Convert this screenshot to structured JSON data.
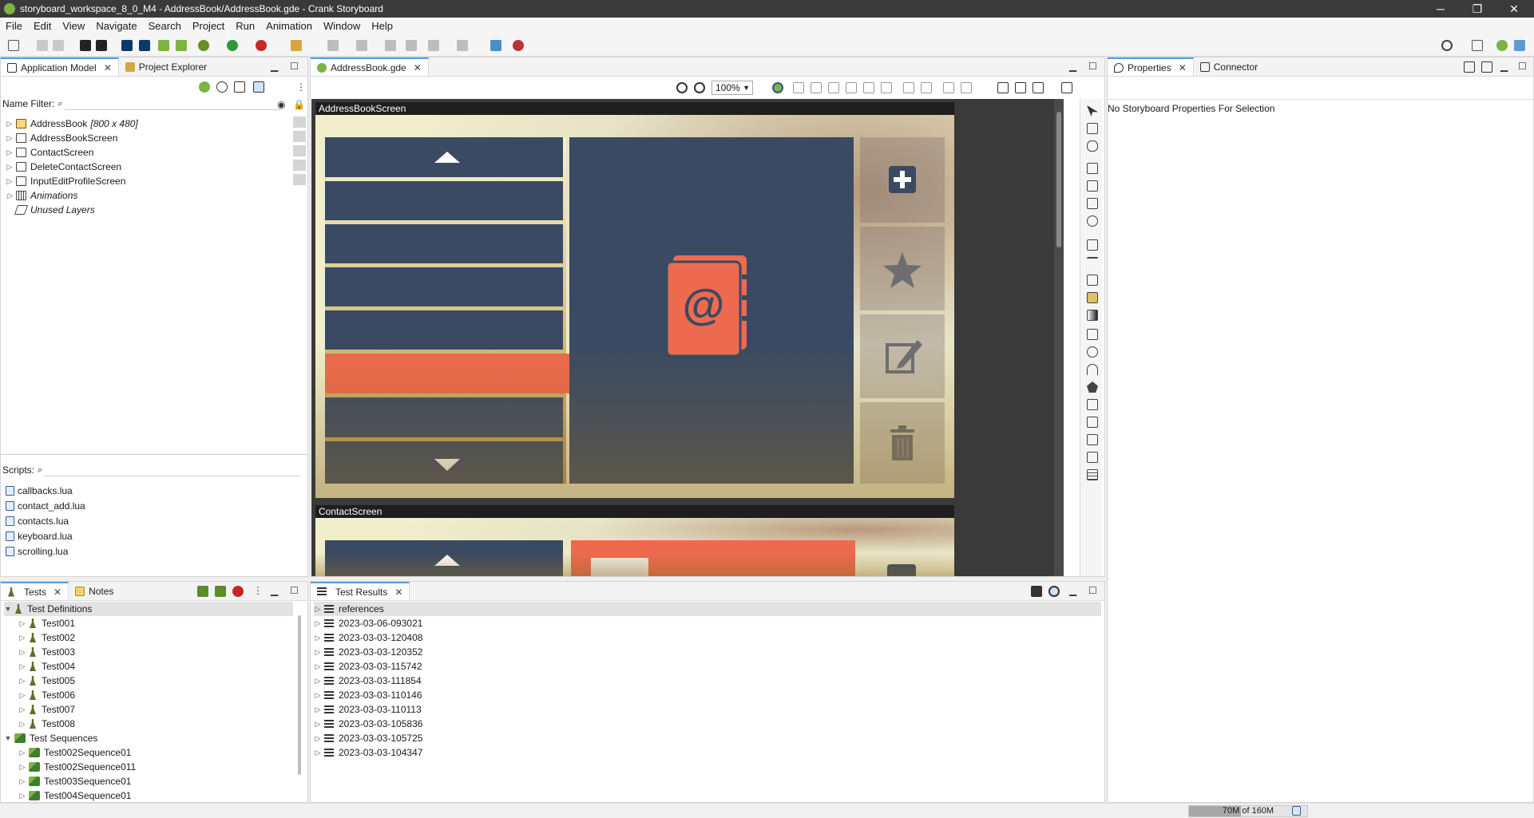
{
  "window": {
    "title": "storyboard_workspace_8_0_M4 - AddressBook/AddressBook.gde - Crank Storyboard",
    "minimize": "─",
    "restore": "❐",
    "close": "✕"
  },
  "menu": [
    "File",
    "Edit",
    "View",
    "Navigate",
    "Search",
    "Project",
    "Run",
    "Animation",
    "Window",
    "Help"
  ],
  "left_top": {
    "tabs": [
      {
        "label": "Application Model"
      },
      {
        "label": "Project Explorer"
      }
    ],
    "name_filter_label": "Name Filter:",
    "tree": [
      {
        "name": "AddressBook",
        "suffix": "[800 x 480]"
      },
      {
        "name": "AddressBookScreen"
      },
      {
        "name": "ContactScreen"
      },
      {
        "name": "DeleteContactScreen"
      },
      {
        "name": "InputEditProfileScreen"
      },
      {
        "name": "Animations"
      },
      {
        "name": "Unused Layers"
      }
    ],
    "scripts_label": "Scripts:",
    "scripts": [
      "callbacks.lua",
      "contact_add.lua",
      "contacts.lua",
      "keyboard.lua",
      "scrolling.lua"
    ]
  },
  "editor": {
    "tab": "AddressBook.gde",
    "zoom": "100%",
    "screens": [
      "AddressBookScreen",
      "ContactScreen"
    ]
  },
  "properties": {
    "tabs": [
      {
        "label": "Properties"
      },
      {
        "label": "Connector"
      }
    ],
    "empty_message": "No Storyboard Properties For Selection"
  },
  "tests": {
    "tabs": [
      {
        "label": "Tests"
      },
      {
        "label": "Notes"
      }
    ],
    "definitions_label": "Test Definitions",
    "definitions": [
      "Test001",
      "Test002",
      "Test003",
      "Test004",
      "Test005",
      "Test006",
      "Test007",
      "Test008"
    ],
    "sequences_label": "Test Sequences",
    "sequences": [
      "Test002Sequence01",
      "Test002Sequence011",
      "Test003Sequence01",
      "Test004Sequence01"
    ]
  },
  "test_results": {
    "tab": "Test Results",
    "items": [
      "references",
      "2023-03-06-093021",
      "2023-03-03-120408",
      "2023-03-03-120352",
      "2023-03-03-115742",
      "2023-03-03-111854",
      "2023-03-03-110146",
      "2023-03-03-110113",
      "2023-03-03-105836",
      "2023-03-03-105725",
      "2023-03-03-104347"
    ]
  },
  "status": {
    "memory": "70M of 160M",
    "memory_fraction": 0.4375
  },
  "colors": {
    "navy": "#3a4a62",
    "coral": "#ee6a4e",
    "accent": "#5a9bd5"
  }
}
